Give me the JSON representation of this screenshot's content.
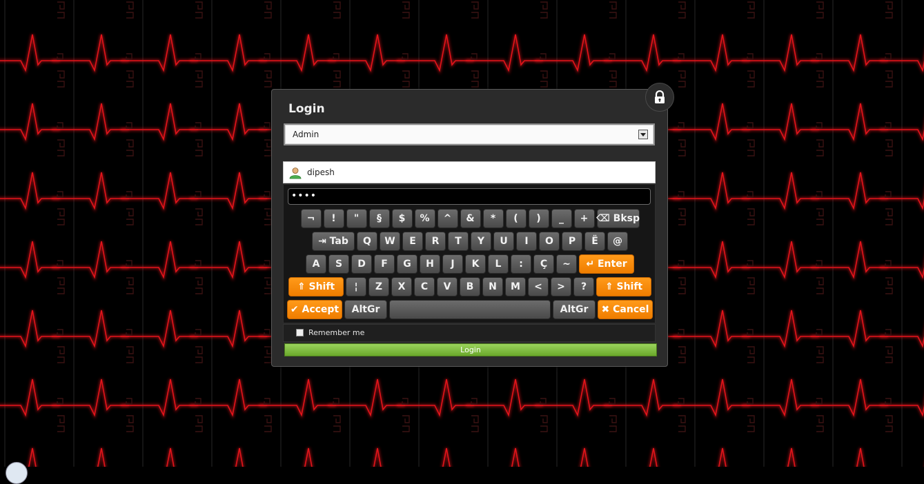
{
  "background": {
    "color": "#000000",
    "accent": "#e3141a"
  },
  "login": {
    "title": "Login",
    "role_select": {
      "value": "Admin"
    },
    "username": {
      "value": "dipesh"
    },
    "password": {
      "masked_value": "••••"
    },
    "remember_label": "Remember me",
    "remember_checked": false,
    "submit_label": "Login"
  },
  "keyboard": {
    "rows": [
      [
        {
          "label": "¬"
        },
        {
          "label": "!"
        },
        {
          "label": "\""
        },
        {
          "label": "§"
        },
        {
          "label": "$"
        },
        {
          "label": "%"
        },
        {
          "label": "^"
        },
        {
          "label": "&"
        },
        {
          "label": "*"
        },
        {
          "label": "("
        },
        {
          "label": ")"
        },
        {
          "label": "_"
        },
        {
          "label": "+"
        },
        {
          "label": "⌫ Bksp"
        }
      ],
      [
        {
          "label": "⇥ Tab"
        },
        {
          "label": "Q"
        },
        {
          "label": "W"
        },
        {
          "label": "E"
        },
        {
          "label": "R"
        },
        {
          "label": "T"
        },
        {
          "label": "Y"
        },
        {
          "label": "U"
        },
        {
          "label": "I"
        },
        {
          "label": "O"
        },
        {
          "label": "P"
        },
        {
          "label": "Ë"
        },
        {
          "label": "@"
        }
      ],
      [
        {
          "label": "A"
        },
        {
          "label": "S"
        },
        {
          "label": "D"
        },
        {
          "label": "F"
        },
        {
          "label": "G"
        },
        {
          "label": "H"
        },
        {
          "label": "J"
        },
        {
          "label": "K"
        },
        {
          "label": "L"
        },
        {
          "label": ":"
        },
        {
          "label": "Ç"
        },
        {
          "label": "~"
        },
        {
          "label": "↵ Enter",
          "style": "orange"
        }
      ],
      [
        {
          "label": "⇑ Shift",
          "style": "orange"
        },
        {
          "label": "¦"
        },
        {
          "label": "Z"
        },
        {
          "label": "X"
        },
        {
          "label": "C"
        },
        {
          "label": "V"
        },
        {
          "label": "B"
        },
        {
          "label": "N"
        },
        {
          "label": "M"
        },
        {
          "label": "<"
        },
        {
          "label": ">"
        },
        {
          "label": "?"
        },
        {
          "label": "⇑ Shift",
          "style": "orange"
        }
      ],
      [
        {
          "label": "✔ Accept",
          "style": "orange"
        },
        {
          "label": "AltGr"
        },
        {
          "label": "",
          "style": "space"
        },
        {
          "label": "AltGr"
        },
        {
          "label": "✖ Cancel",
          "style": "orange"
        }
      ]
    ]
  },
  "icons": {
    "lock": "lock-icon",
    "user": "user-icon",
    "dropdown": "chevron-down-icon"
  }
}
